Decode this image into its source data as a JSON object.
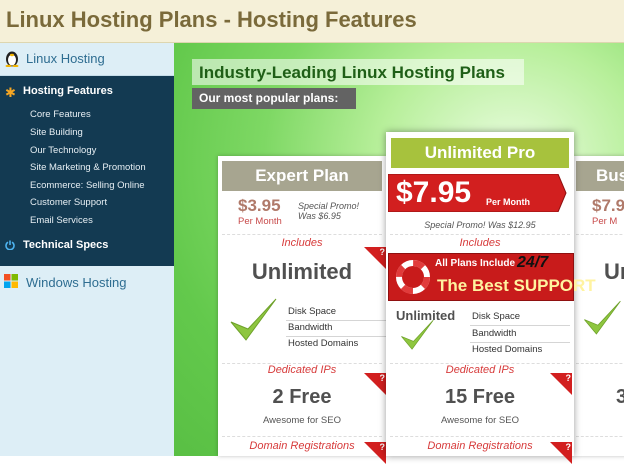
{
  "header": {
    "title": "Linux Hosting Plans - Hosting Features"
  },
  "sidebar": {
    "top_label": "Linux Hosting",
    "section_label": "Hosting Features",
    "items": [
      "Core Features",
      "Site Building",
      "Our Technology",
      "Site Marketing & Promotion",
      "Ecommerce: Selling Online",
      "Customer Support",
      "Email Services"
    ],
    "tech_label": "Technical Specs",
    "windows_label": "Windows Hosting"
  },
  "main": {
    "heading": "Industry-Leading Linux Hosting Plans",
    "subheading": "Our most popular plans:"
  },
  "plans": [
    {
      "name": "Expert Plan",
      "price": "$3.95",
      "per_month": "Per Month",
      "promo_line1": "Special Promo!",
      "promo_line2": "Was $6.95",
      "includes": "Includes",
      "storage": "Unlimited",
      "features": [
        "Disk Space",
        "Bandwidth",
        "Hosted Domains"
      ],
      "ips_label": "Dedicated IPs",
      "ips_value": "2 Free",
      "seo": "Awesome for SEO",
      "domains_label": "Domain Registrations",
      "badge": "?"
    },
    {
      "name": "Unlimited Pro",
      "price": "$7.95",
      "per_month": "Per Month",
      "promo": "Special Promo! Was $12.95",
      "includes": "Includes",
      "banner_top": "All Plans Include",
      "banner_247": "24/7",
      "banner_main": "The Best SUPPORT",
      "storage": "Unlimited",
      "features": [
        "Disk Space",
        "Bandwidth",
        "Hosted Domains"
      ],
      "ips_label": "Dedicated IPs",
      "ips_value": "15 Free",
      "seo": "Awesome for SEO",
      "domains_label": "Domain Registrations",
      "badge": "?"
    },
    {
      "name": "Bus",
      "price": "$7.9",
      "per_month": "Per M",
      "storage": "Ur",
      "ips_value": "3"
    }
  ],
  "colors": {
    "accent": "#8bb83a",
    "price_red": "#d21f1f",
    "navy": "#133a52",
    "green_bg": "#63c94c"
  }
}
